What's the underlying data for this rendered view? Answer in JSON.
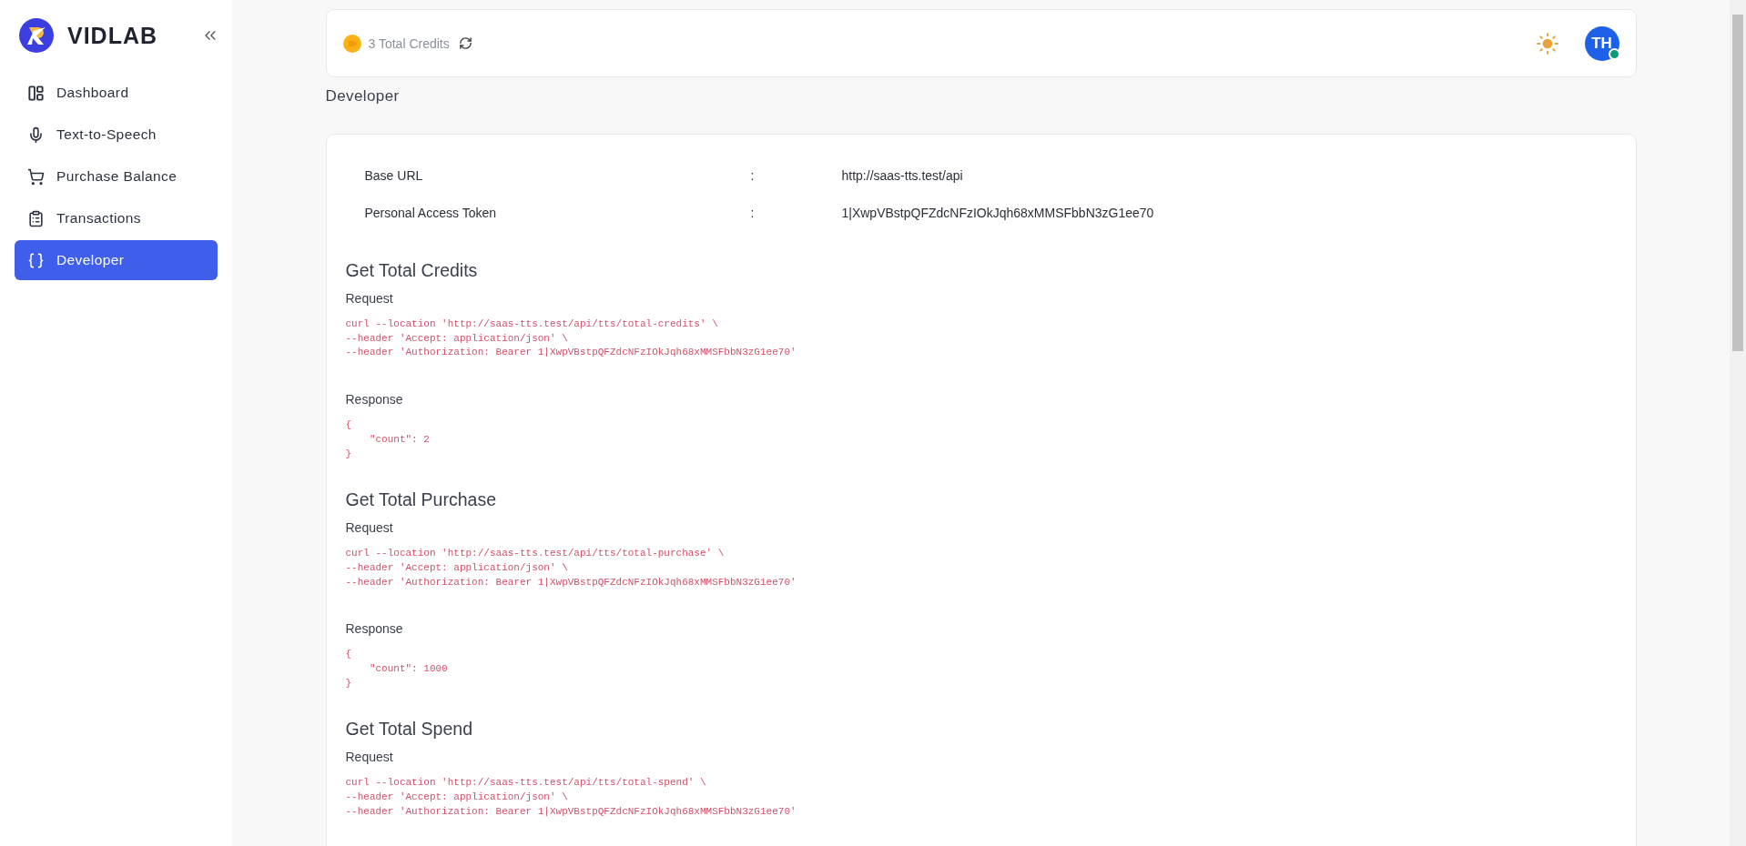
{
  "sidebar": {
    "brand": "VIDLAB",
    "items": [
      {
        "label": "Dashboard",
        "kind": "dashboard",
        "selected": false
      },
      {
        "label": "Text-to-Speech",
        "kind": "mic",
        "selected": false
      },
      {
        "label": "Purchase Balance",
        "kind": "cart",
        "selected": false
      },
      {
        "label": "Transactions",
        "kind": "clipboard",
        "selected": false
      },
      {
        "label": "Developer",
        "kind": "braces",
        "selected": true
      }
    ]
  },
  "header": {
    "credits": "3 Total Credits",
    "avatar": {
      "initials": "TH",
      "online": true
    }
  },
  "page_title": "Developer",
  "info_rows": [
    {
      "label": "Base URL",
      "separator": ":",
      "value": "http://saas-tts.test/api"
    },
    {
      "label": "Personal Access Token",
      "separator": ":",
      "value": "1|XwpVBstpQFZdcNFzIOkJqh68xMMSFbbN3zG1ee70"
    }
  ],
  "sections": [
    {
      "title": "Get Total Credits",
      "request_label": "Request",
      "request": [
        "curl --location 'http://saas-tts.test/api/tts/total-credits' \\",
        "--header 'Accept: application/json' \\",
        "--header 'Authorization: Bearer 1|XwpVBstpQFZdcNFzIOkJqh68xMMSFbbN3zG1ee70'"
      ],
      "response_label": "Response",
      "response": [
        "{",
        "    \"count\": 2",
        "}"
      ]
    },
    {
      "title": "Get Total Purchase",
      "request_label": "Request",
      "request": [
        "curl --location 'http://saas-tts.test/api/tts/total-purchase' \\",
        "--header 'Accept: application/json' \\",
        "--header 'Authorization: Bearer 1|XwpVBstpQFZdcNFzIOkJqh68xMMSFbbN3zG1ee70'"
      ],
      "response_label": "Response",
      "response": [
        "{",
        "    \"count\": 1000",
        "}"
      ]
    },
    {
      "title": "Get Total Spend",
      "request_label": "Request",
      "request": [
        "curl --location 'http://saas-tts.test/api/tts/total-spend' \\",
        "--header 'Accept: application/json' \\",
        "--header 'Authorization: Bearer 1|XwpVBstpQFZdcNFzIOkJqh68xMMSFbbN3zG1ee70'"
      ]
    }
  ]
}
